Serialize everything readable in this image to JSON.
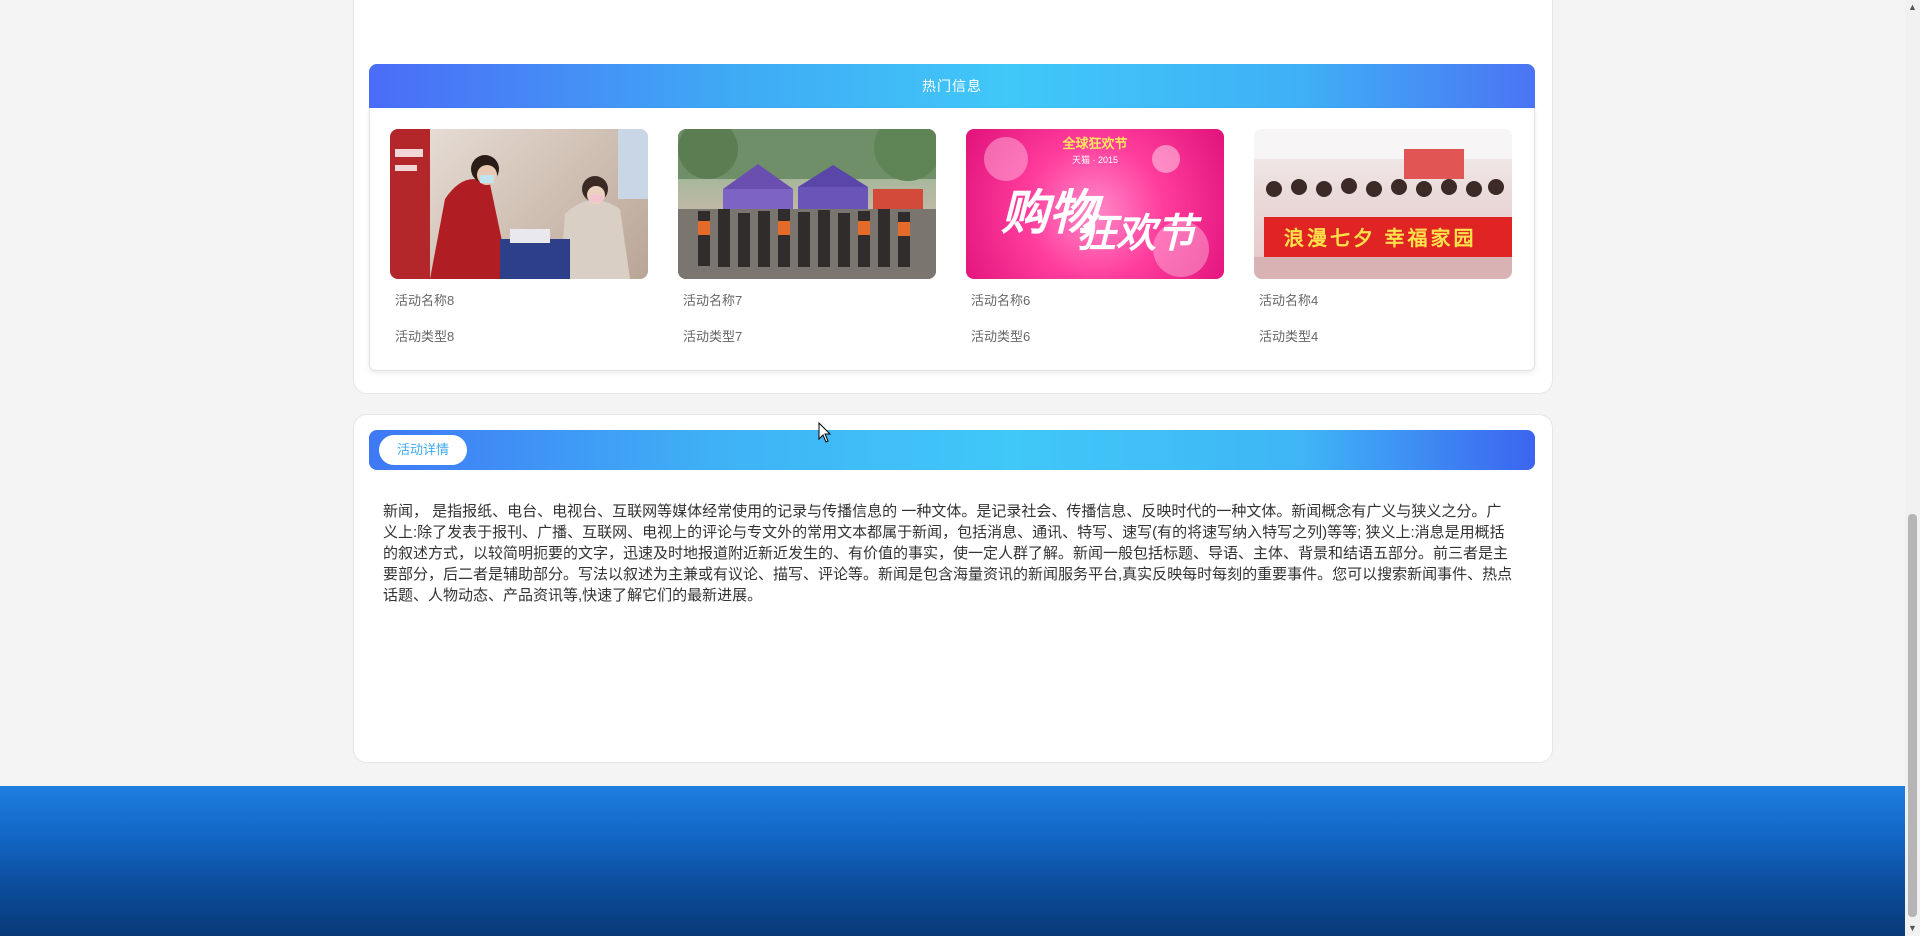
{
  "hot_section": {
    "title": "热门信息",
    "items": [
      {
        "name": "活动名称8",
        "type": "活动类型8"
      },
      {
        "name": "活动名称7",
        "type": "活动类型7"
      },
      {
        "name": "活动名称6",
        "type": "活动类型6"
      },
      {
        "name": "活动名称4",
        "type": "活动类型4"
      }
    ]
  },
  "thumb_text": {
    "t3_top": "全球狂欢节",
    "t3_year": "天猫 · 2015",
    "t3_big1": "购物",
    "t3_big2": "狂欢节",
    "t4_banner": "浪漫七夕 幸福家园"
  },
  "detail": {
    "tab_label": "活动详情",
    "content": "新闻， 是指报纸、电台、电视台、互联网等媒体经常使用的记录与传播信息的 一种文体。是记录社会、传播信息、反映时代的一种文体。新闻概念有广义与狭义之分。广义上:除了发表于报刊、广播、互联网、电视上的评论与专文外的常用文本都属于新闻，包括消息、通讯、特写、速写(有的将速写纳入特写之列)等等; 狭义上:消息是用概括的叙述方式，以较简明扼要的文字，迅速及时地报道附近新近发生的、有价值的事实，使一定人群了解。新闻一般包括标题、导语、主体、背景和结语五部分。前三者是主要部分，后二者是辅助部分。写法以叙述为主兼或有议论、描写、评论等。新闻是包含海量资讯的新闻服务平台,真实反映每时每刻的重要事件。您可以搜索新闻事件、热点话题、人物动态、产品资讯等,快速了解它们的最新进展。"
  },
  "colors": {
    "accent_blue": "#3fa8f5",
    "footer_blue": "#1265c4"
  }
}
